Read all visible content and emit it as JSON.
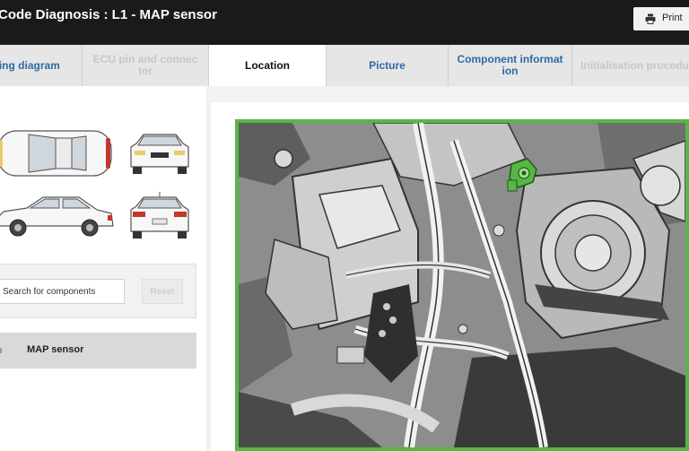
{
  "header": {
    "title": "Code Diagnosis : L1 - MAP sensor",
    "print_label": "Print"
  },
  "tabs": [
    {
      "label": "ring diagram",
      "state": "link"
    },
    {
      "label": "ECU pin and connec\ntor",
      "state": "disabled"
    },
    {
      "label": "Location",
      "state": "active"
    },
    {
      "label": "Picture",
      "state": "link"
    },
    {
      "label": "Component informat\nion",
      "state": "link"
    },
    {
      "label": "Initialisation procedu",
      "state": "disabled"
    }
  ],
  "search": {
    "placeholder": "Search for components",
    "reset_label": "Reset"
  },
  "results": [
    {
      "label": "MAP sensor"
    }
  ],
  "colors": {
    "header_bg": "#1a1a1a",
    "link_blue": "#2e6aa6",
    "highlight_green": "#58b647"
  }
}
